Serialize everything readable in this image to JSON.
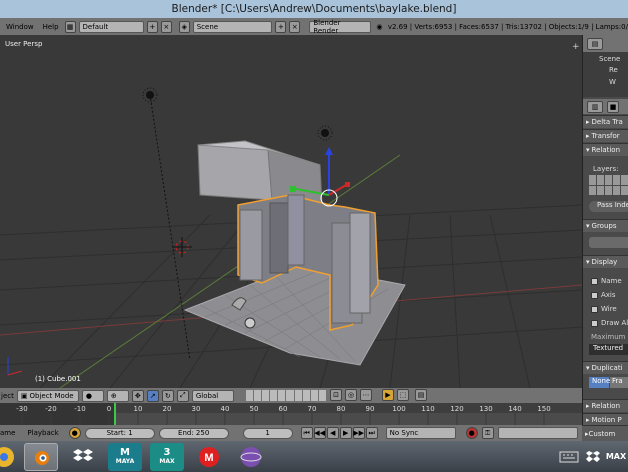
{
  "window": {
    "title": "Blender* [C:\\Users\\Andrew\\Documents\\baylake.blend]"
  },
  "topbar": {
    "menus": [
      "Window",
      "Help"
    ],
    "layout": "Default",
    "scene": "Scene",
    "engine": "Blender Render",
    "stats": "v2.69 | Verts:6953 | Faces:6537 | Tris:13702 | Objects:1/9 | Lamps:0/"
  },
  "viewport": {
    "view_label": "User Persp",
    "object_label": "(1) Cube.001"
  },
  "properties": {
    "outliner_items": [
      "Scene",
      "Re",
      "W"
    ],
    "sections": {
      "delta": "Delta Tra",
      "transform": "Transfor",
      "relations": "Relation",
      "layers_label": "Layers:",
      "pass_index": "Pass Inde",
      "groups": "Groups",
      "display": "Display",
      "display_opts": [
        "Name",
        "Axis",
        "Wire",
        "Draw Al"
      ],
      "maximum": "Maximum",
      "textured": "Textured",
      "duplication": "Duplicati",
      "dup_none": "None",
      "dup_fra": "Fra",
      "relations_ext": "Relation",
      "motion_paths": "Motion P",
      "custom_props": "Custom"
    }
  },
  "viewport_header": {
    "object_menu": "ject",
    "mode": "Object Mode",
    "orientation": "Global"
  },
  "timeline": {
    "ticks": [
      "-30",
      "-20",
      "-10",
      "0",
      "10",
      "20",
      "30",
      "40",
      "50",
      "60",
      "70",
      "80",
      "90",
      "100",
      "110",
      "120",
      "130",
      "140",
      "150"
    ],
    "current_frame_marker": 0
  },
  "timeline_header": {
    "frame_menu": "ame",
    "playback_menu": "Playback",
    "start": "Start: 1",
    "end": "End: 250",
    "current": "1",
    "sync": "No Sync"
  },
  "taskbar": {
    "apps": [
      "chrome-icon",
      "blender-icon",
      "dropbox-icon",
      "maya-icon",
      "3dsmax-icon",
      "makerbot-icon",
      "browser-icon"
    ],
    "app_labels": {
      "maya": "MAYA",
      "max": "MAX"
    }
  },
  "colors": {
    "titlebar": "#a9c3da",
    "viewport_bg": "#393939",
    "selection_outline": "#f0a030",
    "frame_marker": "#3ec84a",
    "header_gray": "#727272"
  }
}
